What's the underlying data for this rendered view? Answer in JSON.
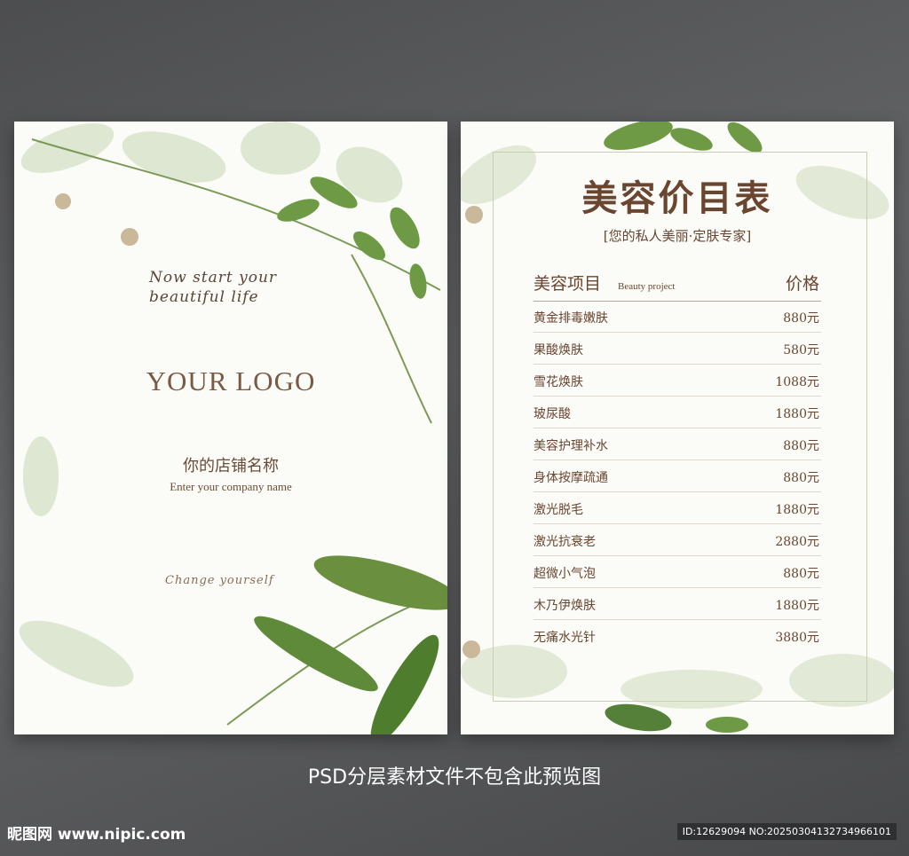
{
  "left_card": {
    "script_top": "Now start your beautiful life",
    "logo": "YOUR LOGO",
    "shop_name_cn": "你的店铺名称",
    "shop_name_en": "Enter your company name",
    "script_bottom": "Change yourself"
  },
  "right_card": {
    "title": "美容价目表",
    "subtitle": "[您的私人美丽·定肤专家]",
    "header": {
      "item": "美容项目",
      "item_en": "Beauty project",
      "price": "价格"
    },
    "items": [
      {
        "name": "黄金排毒嫩肤",
        "price": "880元"
      },
      {
        "name": "果酸焕肤",
        "price": "580元"
      },
      {
        "name": "雪花焕肤",
        "price": "1088元"
      },
      {
        "name": "玻尿酸",
        "price": "1880元"
      },
      {
        "name": "美容护理补水",
        "price": "880元"
      },
      {
        "name": "身体按摩疏通",
        "price": "880元"
      },
      {
        "name": "激光脱毛",
        "price": "1880元"
      },
      {
        "name": "激光抗衰老",
        "price": "2880元"
      },
      {
        "name": "超微小气泡",
        "price": "880元"
      },
      {
        "name": "木乃伊焕肤",
        "price": "1880元"
      },
      {
        "name": "无痛水光针",
        "price": "3880元"
      }
    ]
  },
  "preview_note": "PSD分层素材文件不包含此预览图",
  "watermark": {
    "site": "昵图网 www.nipic.com",
    "id": "ID:12629094 NO:20250304132734966101"
  },
  "colors": {
    "text_brown": "#6a4530",
    "leaf_green": "#5f8a3a",
    "background": "#5a5b5d"
  }
}
